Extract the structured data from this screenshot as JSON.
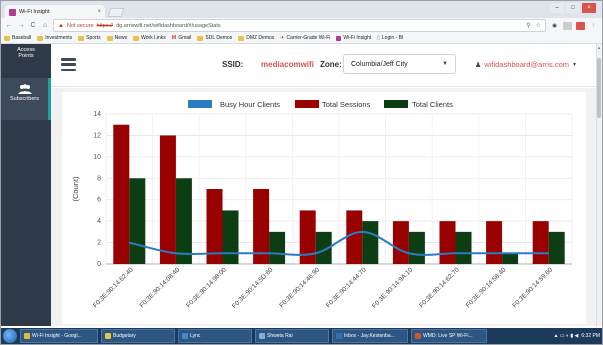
{
  "browser": {
    "tab_title": "Wi-Fi Insight",
    "tab_close": "×",
    "nav": {
      "back": "←",
      "forward": "→",
      "reload": "C",
      "home": "⌂"
    },
    "security_label": "Not secure",
    "url_scheme": "https://",
    "url_rest": "dg.arriswifi.net/wifidashboard/#/usageStats",
    "omnibox_icons": [
      "star-icon",
      "share-icon"
    ],
    "window_buttons": {
      "minimize": "–",
      "maximize": "□",
      "close": "×"
    },
    "bookmarks": [
      {
        "label": "Baseball",
        "icon": "folder-icon"
      },
      {
        "label": "Investments",
        "icon": "folder-icon"
      },
      {
        "label": "Sports",
        "icon": "folder-icon"
      },
      {
        "label": "News",
        "icon": "folder-icon"
      },
      {
        "label": "Work Links",
        "icon": "folder-icon"
      },
      {
        "label": "Gmail",
        "icon": "gmail-icon"
      },
      {
        "label": "SDL Demos",
        "icon": "folder-icon"
      },
      {
        "label": "DMZ Demos",
        "icon": "folder-icon"
      },
      {
        "label": "Carrier-Grade Wi-Fi",
        "icon": "bookmark-icon"
      },
      {
        "label": "Wi-Fi Insight",
        "icon": "wifi-insight-icon"
      },
      {
        "label": "Login - BI",
        "icon": "page-icon"
      }
    ]
  },
  "sidebar": {
    "items": [
      {
        "label_line1": "Access",
        "label_line2": "Points",
        "icon": "access-points-icon"
      },
      {
        "label": "Subscribers",
        "icon": "people-icon",
        "active": true
      }
    ]
  },
  "header": {
    "ssid_label": "SSID:",
    "ssid_value": "mediacomwifi",
    "zone_label": "Zone:",
    "zone_value": "Columbia/Jeff City",
    "zone_caret": "▼",
    "user_email": "wifidashboard@arris.com",
    "user_icon": "user-icon",
    "user_caret": "▼"
  },
  "colors": {
    "accent_red": "#d9534f",
    "sidebar": "#2e3a47",
    "sessions": "#990000",
    "clients": "#0d3d13",
    "busy_hour": "#2a7dc0"
  },
  "chart_data": {
    "type": "bar",
    "legend_position": "top-center",
    "ylabel": "(Count)",
    "ylim": [
      0,
      14
    ],
    "yticks": [
      0,
      2,
      4,
      6,
      8,
      10,
      12,
      14
    ],
    "grid": true,
    "categories": [
      "F0:3E:90:14:62:40",
      "F0:3E:90:14:08:40",
      "F0:3E:90:14:98:00",
      "F0:3E:90:14:5D:60",
      "F0:3E:90:14:46:90",
      "F0:3E:90:14:44:70",
      "F0:3E:90:14:9A:10",
      "F0:3E:90:14:62:70",
      "F0:3E:90:14:58:40",
      "F0:3E:90:14:59:60"
    ],
    "series": [
      {
        "name": "Busy Hour Clients",
        "type": "line",
        "color": "#2a7dc0",
        "values": [
          2,
          1,
          1,
          1,
          1,
          3,
          1,
          1,
          1,
          1
        ]
      },
      {
        "name": "Total Sessions",
        "type": "bar",
        "color": "#990000",
        "values": [
          13,
          12,
          7,
          7,
          5,
          5,
          4,
          4,
          4,
          4
        ]
      },
      {
        "name": "Total Clients",
        "type": "bar",
        "color": "#0d3d13",
        "values": [
          8,
          8,
          5,
          3,
          3,
          4,
          3,
          3,
          1,
          3
        ]
      }
    ]
  },
  "taskbar": {
    "items": [
      {
        "label": "Wi-Fi Insight - Googl...",
        "icon": "chrome-icon"
      },
      {
        "label": "Budgetary",
        "icon": "folder-icon"
      },
      {
        "label": "Lync",
        "icon": "lync-icon"
      },
      {
        "label": "Shweta Rai",
        "icon": "chat-icon"
      },
      {
        "label": "Inbox - Jay.Kestenba...",
        "icon": "outlook-icon"
      },
      {
        "label": "WMD: Live SP Wi-Fi...",
        "icon": "powerpoint-icon"
      }
    ],
    "clock": "6:32 PM"
  }
}
